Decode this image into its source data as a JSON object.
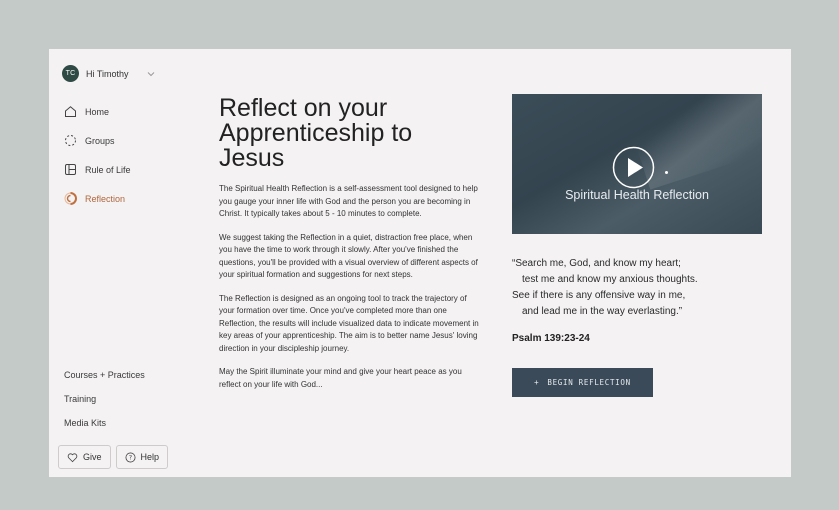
{
  "user": {
    "initials": "TC",
    "greeting": "Hi Timothy"
  },
  "nav": {
    "items": [
      {
        "label": "Home",
        "icon": "home-icon"
      },
      {
        "label": "Groups",
        "icon": "groups-icon"
      },
      {
        "label": "Rule of Life",
        "icon": "rule-of-life-icon"
      },
      {
        "label": "Reflection",
        "icon": "reflection-icon",
        "active": true
      }
    ]
  },
  "bottom_links": [
    "Courses + Practices",
    "Training",
    "Media Kits"
  ],
  "buttons": {
    "give": "Give",
    "help": "Help"
  },
  "main": {
    "title": "Reflect on your Apprenticeship to Jesus",
    "paragraphs": [
      "The Spiritual Health Reflection is a self-assessment tool designed to help you gauge your inner life with God and the person you are becoming in Christ. It typically takes about 5 - 10 minutes to complete.",
      "We suggest taking the Reflection in a quiet, distraction free place, when you have the time to work through it slowly. After you've finished the questions, you'll be provided with a visual overview of different aspects of your spiritual formation and suggestions for next steps.",
      "The Reflection is designed as an ongoing tool to track the trajectory of your formation over time. Once you've completed more than one Reflection, the results will include visualized data to indicate movement in key areas of your apprenticeship. The aim is to better name Jesus' loving direction in your discipleship journey.",
      "May the Spirit illuminate your mind and give your heart peace as you reflect on your life with God..."
    ]
  },
  "video": {
    "caption": "Spiritual Health Reflection"
  },
  "quote": {
    "lines": [
      "“Search me, God, and know my heart;",
      "test me and know my anxious thoughts.",
      "See if there is any offensive way in me,",
      "and lead me in the way everlasting.”"
    ],
    "reference": "Psalm 139:23-24"
  },
  "cta": {
    "plus": "+",
    "label": "BEGIN REFLECTION"
  },
  "colors": {
    "background": "#c3cac8",
    "panel": "#f4f2f2",
    "accent": "#b0673f",
    "button": "#3b4a58",
    "avatar": "#2f4a44"
  }
}
